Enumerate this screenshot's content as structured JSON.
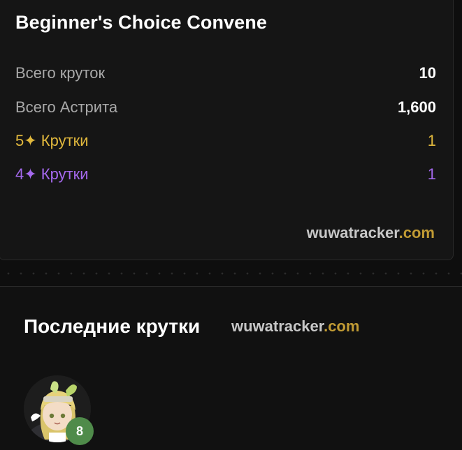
{
  "summary": {
    "title": "Beginner's Choice Convene",
    "stats": [
      {
        "label": "Всего круток",
        "value": "10"
      },
      {
        "label": "Всего Астрита",
        "value": "1,600"
      },
      {
        "label": "5✦ Крутки",
        "value": "1"
      },
      {
        "label": "4✦ Крутки",
        "value": "1"
      }
    ],
    "brand": {
      "name": "wuwatracker",
      "tld": ".com"
    }
  },
  "recent": {
    "title": "Последние крутки",
    "brand": {
      "name": "wuwatracker",
      "tld": ".com"
    },
    "pulls": [
      {
        "pity": "8"
      }
    ]
  },
  "colors": {
    "five_star": "#e2b93d",
    "four_star": "#a569ee",
    "brand_tld": "#c19b34",
    "pity_badge": "#4f8b4a"
  }
}
